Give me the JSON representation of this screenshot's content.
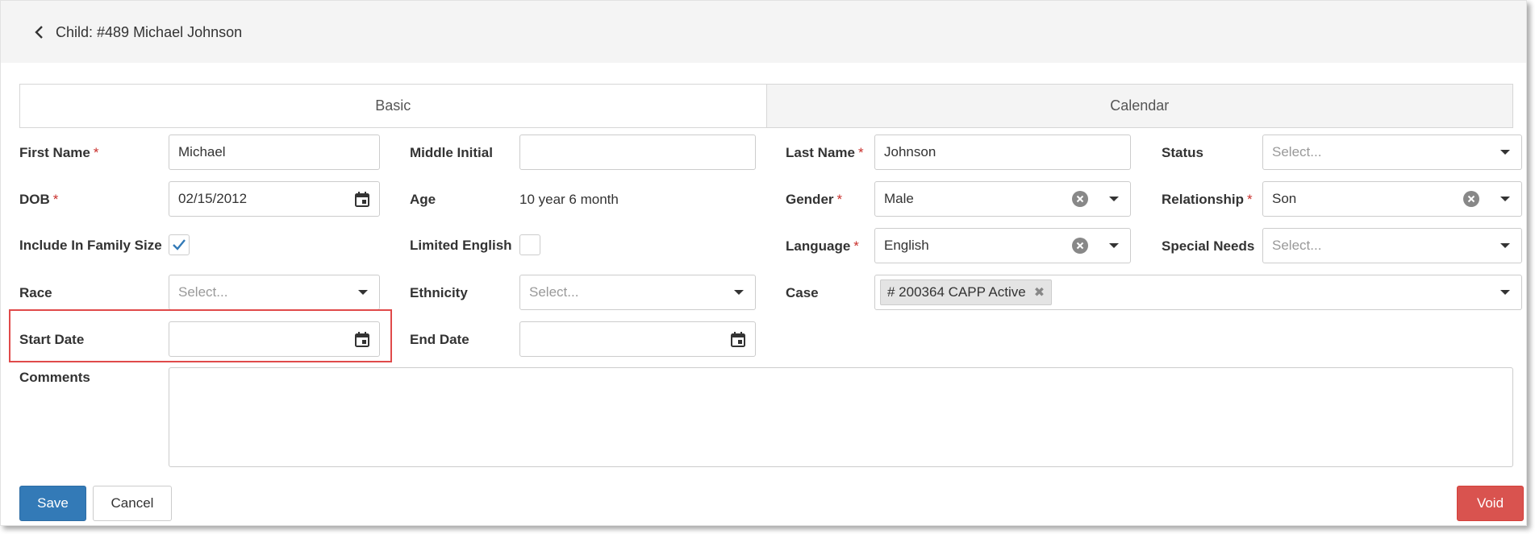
{
  "header": {
    "title": "Child: #489 Michael Johnson"
  },
  "tabs": [
    {
      "label": "Basic"
    },
    {
      "label": "Calendar"
    }
  ],
  "form": {
    "first_name": {
      "label": "First Name",
      "value": "Michael"
    },
    "middle_initial": {
      "label": "Middle Initial",
      "value": ""
    },
    "last_name": {
      "label": "Last Name",
      "value": "Johnson"
    },
    "status": {
      "label": "Status",
      "placeholder": "Select..."
    },
    "dob": {
      "label": "DOB",
      "value": "02/15/2012"
    },
    "age": {
      "label": "Age",
      "value": "10 year 6 month"
    },
    "gender": {
      "label": "Gender",
      "value": "Male"
    },
    "relationship": {
      "label": "Relationship",
      "value": "Son"
    },
    "include_in_family_size": {
      "label": "Include In Family Size",
      "checked": true
    },
    "limited_english": {
      "label": "Limited English",
      "checked": false
    },
    "language": {
      "label": "Language",
      "value": "English"
    },
    "special_needs": {
      "label": "Special Needs",
      "placeholder": "Select..."
    },
    "race": {
      "label": "Race",
      "placeholder": "Select..."
    },
    "ethnicity": {
      "label": "Ethnicity",
      "placeholder": "Select..."
    },
    "case": {
      "label": "Case",
      "tag": "# 200364 CAPP Active"
    },
    "start_date": {
      "label": "Start Date",
      "value": ""
    },
    "end_date": {
      "label": "End Date",
      "value": ""
    },
    "comments": {
      "label": "Comments",
      "value": ""
    },
    "required_mark": "*"
  },
  "buttons": {
    "save": "Save",
    "cancel": "Cancel",
    "void": "Void"
  },
  "colors": {
    "primary": "#337ab7",
    "danger": "#d9534f",
    "highlight": "#e04a4a",
    "check": "#337ab7"
  }
}
